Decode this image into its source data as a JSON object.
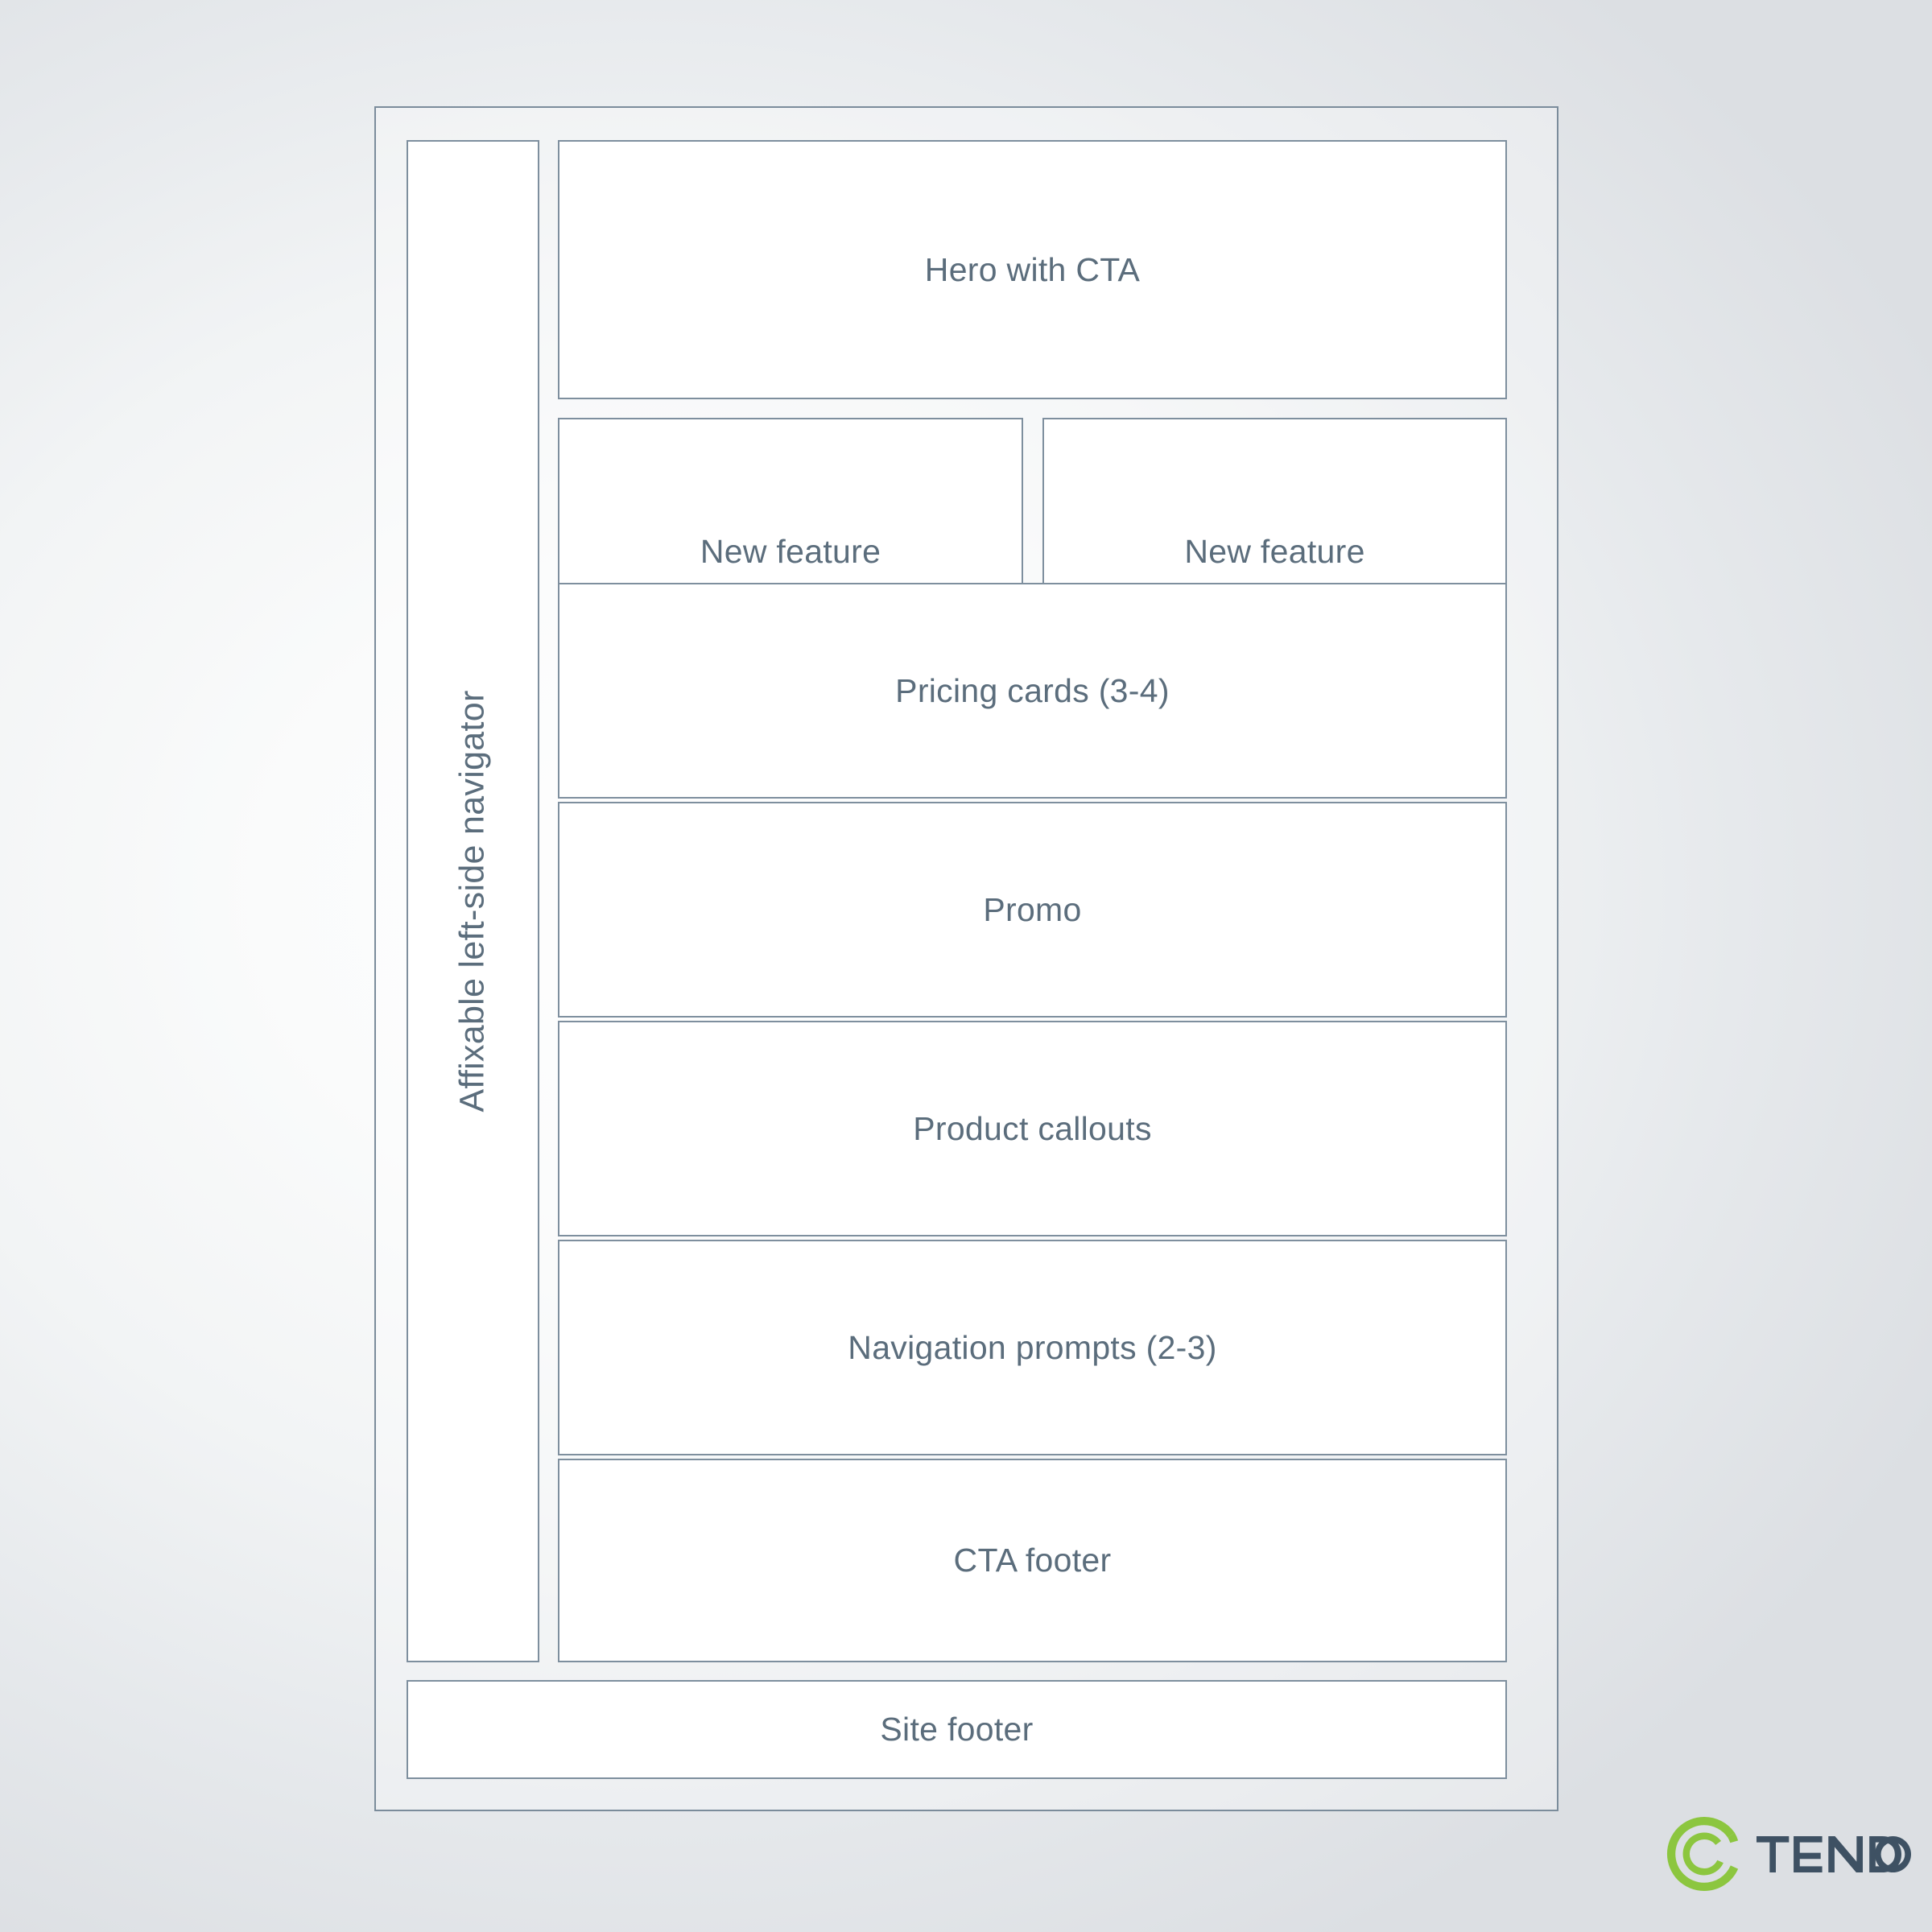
{
  "page": {
    "type": "website-wireframe",
    "background_colors": {
      "center": "#fdfdfe",
      "edge": "#dcdfe3"
    },
    "line_color": "#7e8f9e",
    "label_color": "#5b6d7c",
    "block_fill": "#ffffff"
  },
  "wireframe": {
    "sidebar": {
      "label": "Affixable left-side navigator",
      "orientation": "vertical-rotated-ccw"
    },
    "blocks": [
      {
        "id": "hero",
        "label": "Hero with CTA"
      },
      {
        "id": "feature-left",
        "label": "New feature"
      },
      {
        "id": "feature-right",
        "label": "New feature"
      },
      {
        "id": "pricing-cards",
        "label": "Pricing cards (3-4)"
      },
      {
        "id": "promo",
        "label": "Promo"
      },
      {
        "id": "product-callouts",
        "label": "Product callouts"
      },
      {
        "id": "nav-prompts",
        "label": "Navigation prompts (2-3)"
      },
      {
        "id": "cta-footer",
        "label": "CTA footer"
      },
      {
        "id": "site-footer",
        "label": "Site footer"
      }
    ]
  },
  "logo": {
    "wordmark": "TENDO",
    "mark_name": "tendo-swirl-ring-icon",
    "mark_color": "#8cc63f",
    "wordmark_color": "#3e5163"
  }
}
